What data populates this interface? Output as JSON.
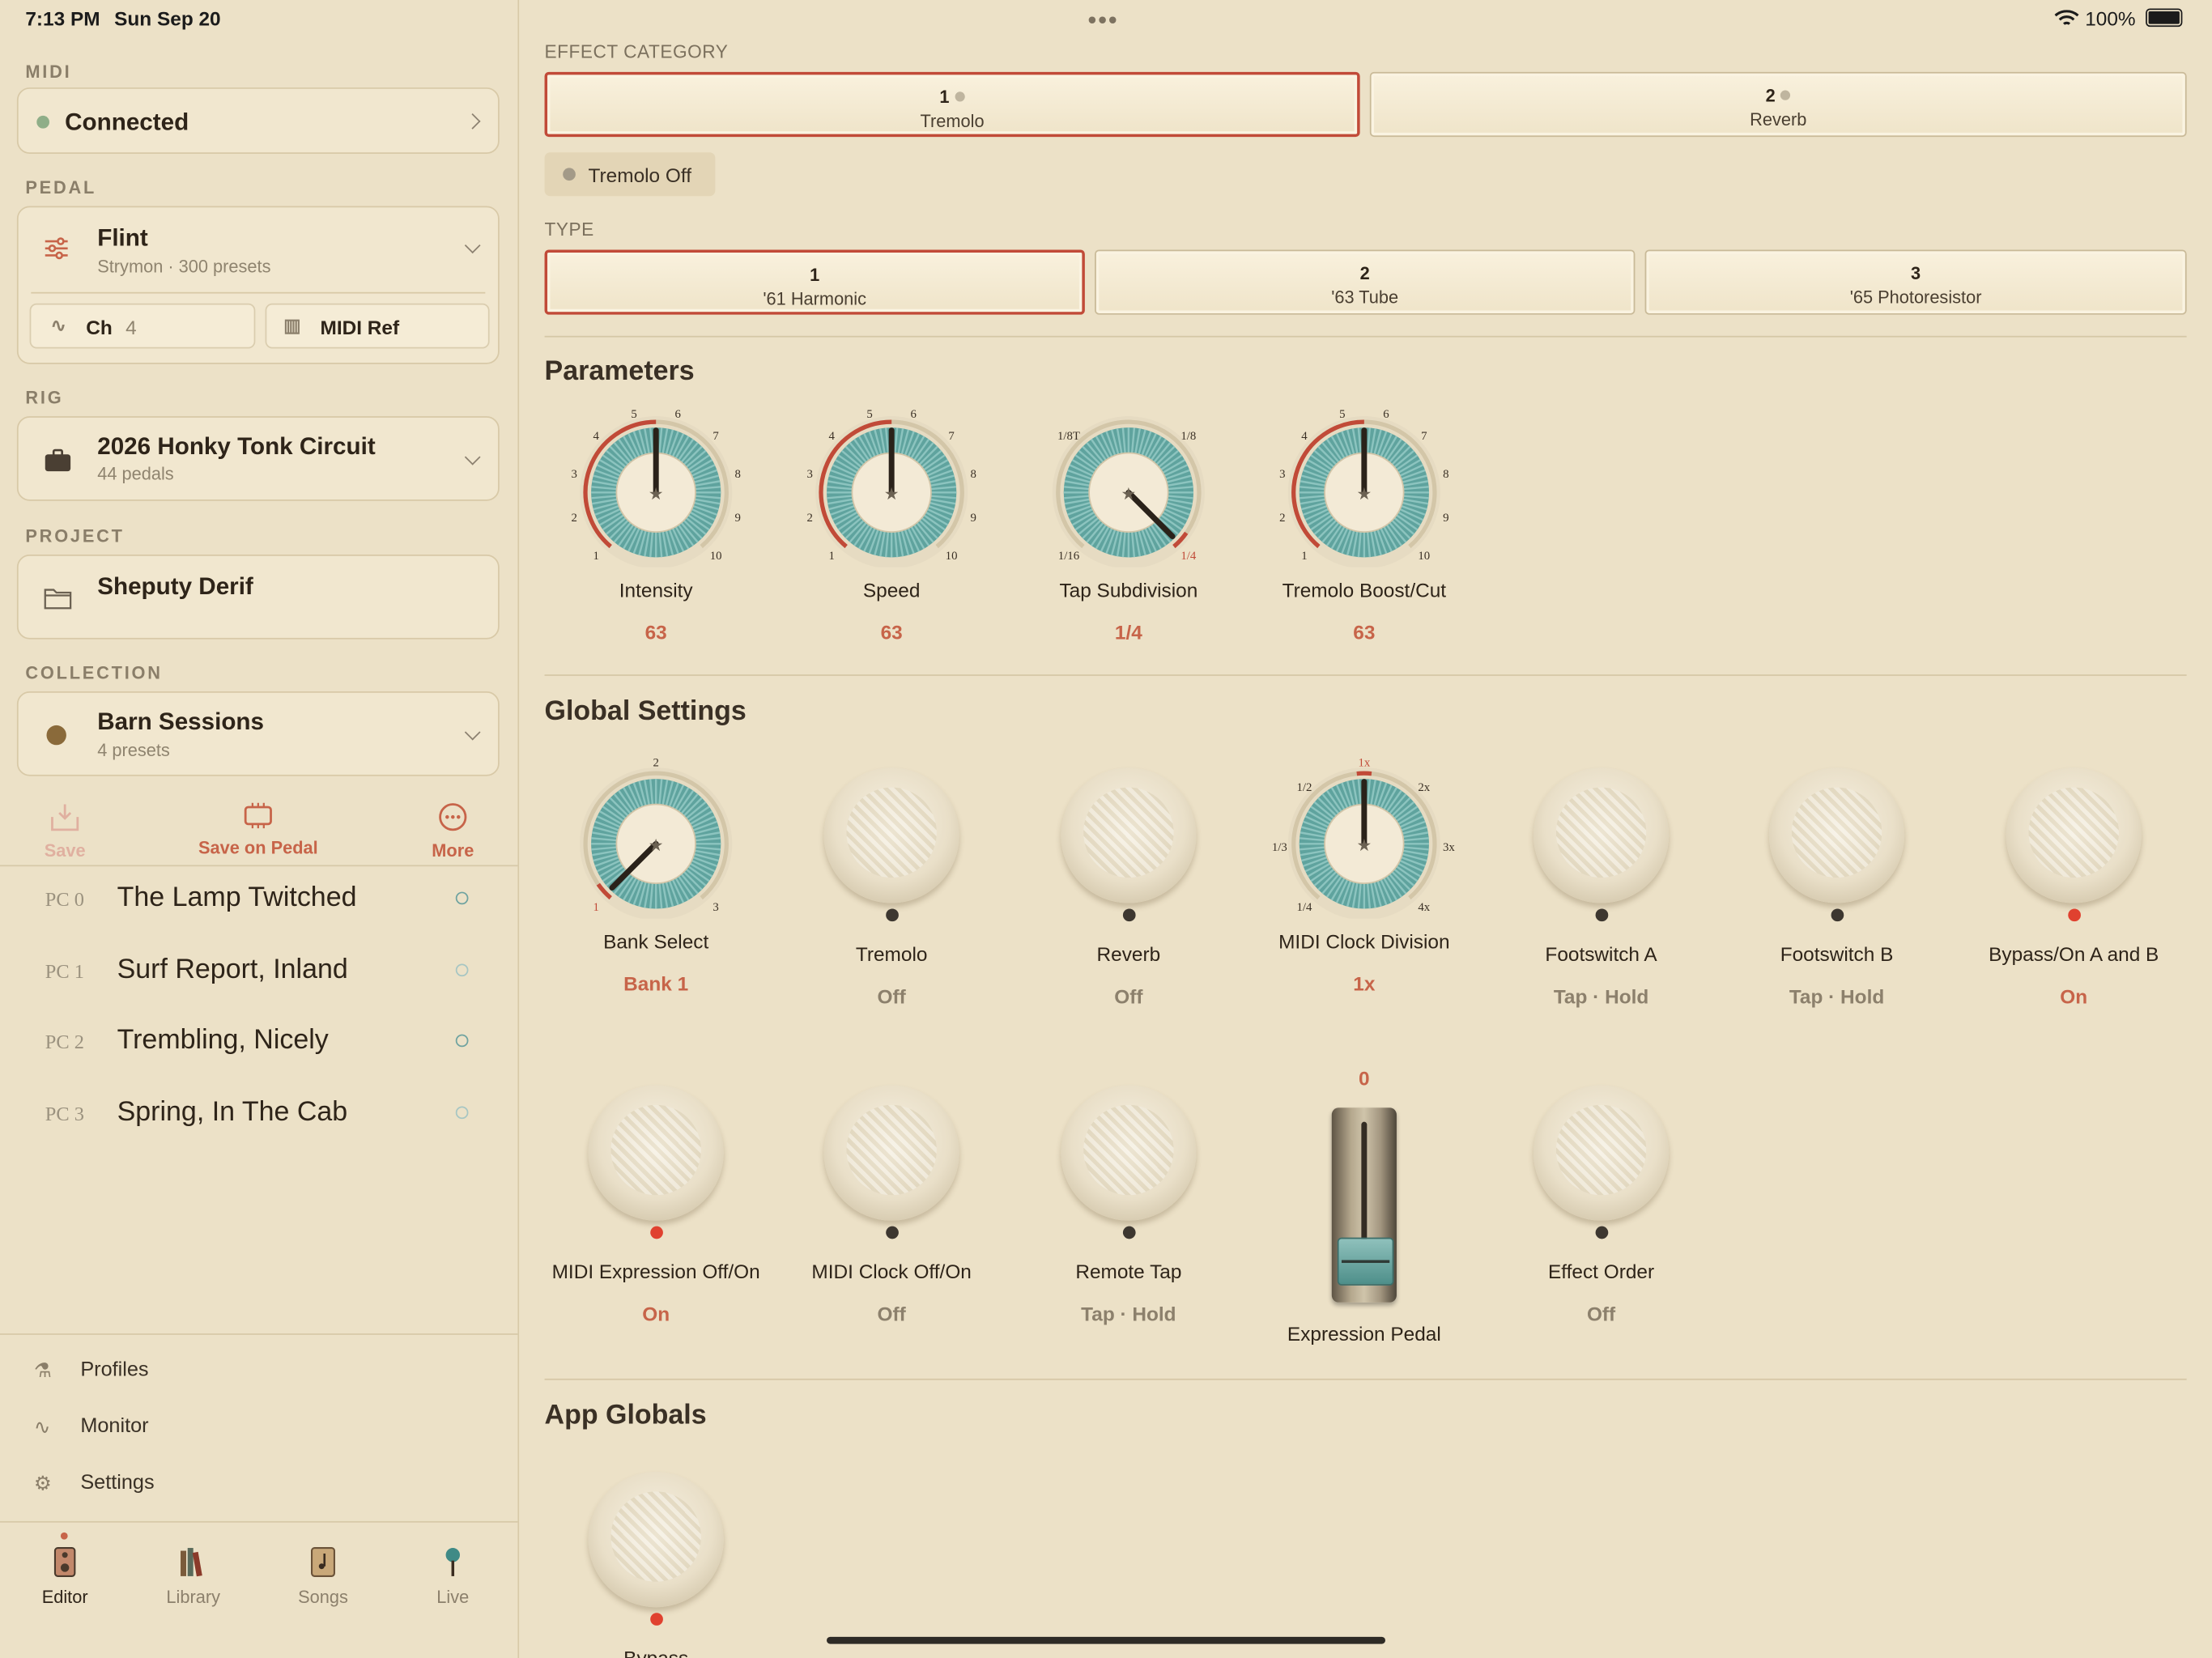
{
  "status_bar": {
    "time": "7:13 PM",
    "date": "Sun Sep 20",
    "battery": "100%"
  },
  "sidebar": {
    "midi": {
      "label": "MIDI",
      "status": "Connected",
      "status_color": "#8fae88"
    },
    "pedal": {
      "label": "PEDAL",
      "name": "Flint",
      "subtitle": "Strymon · 300 presets",
      "channel_label": "Ch",
      "channel_value": "4",
      "midi_ref": "MIDI Ref"
    },
    "rig": {
      "label": "RIG",
      "name": "2026 Honky Tonk Circuit",
      "subtitle": "44 pedals"
    },
    "project": {
      "label": "PROJECT",
      "name": "Sheputy Derif"
    },
    "collection": {
      "label": "COLLECTION",
      "name": "Barn Sessions",
      "subtitle": "4 presets"
    },
    "actions": {
      "save": "Save",
      "save_on_pedal": "Save on Pedal",
      "more": "More"
    },
    "presets": [
      {
        "pc": "PC 0",
        "name": "The Lamp Twitched"
      },
      {
        "pc": "PC 1",
        "name": "Surf Report, Inland"
      },
      {
        "pc": "PC 2",
        "name": "Trembling, Nicely"
      },
      {
        "pc": "PC 3",
        "name": "Spring, In The Cab"
      }
    ],
    "nav": [
      "Profiles",
      "Monitor",
      "Settings"
    ],
    "tabs": [
      "Editor",
      "Library",
      "Songs",
      "Live"
    ]
  },
  "main": {
    "effect_category_label": "EFFECT CATEGORY",
    "categories": [
      {
        "num": "1",
        "label": "Tremolo"
      },
      {
        "num": "2",
        "label": "Reverb"
      }
    ],
    "tremolo_toggle": "Tremolo Off",
    "type_label": "TYPE",
    "types": [
      {
        "num": "1",
        "label": "'61 Harmonic"
      },
      {
        "num": "2",
        "label": "'63 Tube"
      },
      {
        "num": "3",
        "label": "'65 Photoresistor"
      }
    ],
    "parameters_title": "Parameters",
    "parameters": [
      {
        "name": "Intensity",
        "value": "63",
        "ticks": [
          "1",
          "2",
          "3",
          "4",
          "5",
          "6",
          "7",
          "8",
          "9",
          "10"
        ]
      },
      {
        "name": "Speed",
        "value": "63",
        "ticks": [
          "1",
          "2",
          "3",
          "4",
          "5",
          "6",
          "7",
          "8",
          "9",
          "10"
        ]
      },
      {
        "name": "Tap Subdivision",
        "value": "1/4",
        "ticks": [
          "1/8T",
          "1/8",
          "1/16",
          "1/4"
        ]
      },
      {
        "name": "Tremolo Boost/Cut",
        "value": "63",
        "ticks": [
          "1",
          "2",
          "3",
          "4",
          "5",
          "6",
          "7",
          "8",
          "9",
          "10"
        ]
      }
    ],
    "global_title": "Global Settings",
    "bank_select": {
      "name": "Bank Select",
      "value": "Bank 1",
      "ticks": [
        "1",
        "2",
        "3"
      ]
    },
    "midi_clock_division": {
      "name": "MIDI Clock Division",
      "value": "1x",
      "ticks": [
        "1x",
        "2x",
        "3x",
        "4x",
        "1/4",
        "1/3",
        "1/2"
      ]
    },
    "switches_row1": [
      {
        "name": "Tremolo",
        "value": "Off"
      },
      {
        "name": "Reverb",
        "value": "Off"
      },
      {
        "name": "Footswitch A",
        "value": "Tap · Hold"
      },
      {
        "name": "Footswitch B",
        "value": "Tap · Hold"
      },
      {
        "name": "Bypass/On A and B",
        "value": "On"
      }
    ],
    "switches_row2": [
      {
        "name": "MIDI Expression Off/On",
        "value": "On"
      },
      {
        "name": "MIDI Clock Off/On",
        "value": "Off"
      },
      {
        "name": "Remote Tap",
        "value": "Tap · Hold"
      },
      {
        "name": "Effect Order",
        "value": "Off"
      }
    ],
    "expression": {
      "name": "Expression Pedal",
      "value": "0"
    },
    "app_globals_title": "App Globals",
    "bypass": {
      "name": "Bypass"
    }
  }
}
